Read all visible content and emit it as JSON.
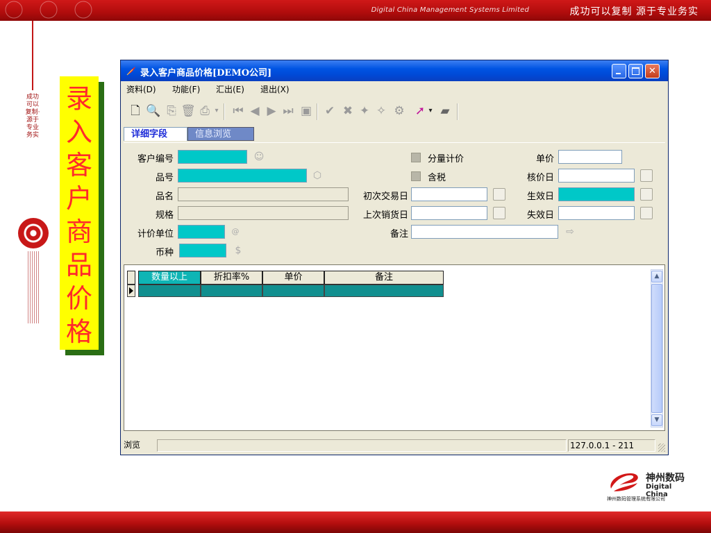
{
  "header": {
    "tagline_en": "Digital China Management Systems Limited",
    "tagline_cn": "成功可以复制   源于专业务实"
  },
  "side_deco_text": "成功可以复制·源于专业务实",
  "slide_title": "录入客户商品价格",
  "window": {
    "title": "录入客户商品价格[DEMO公司]",
    "menu": [
      "资料(D)",
      "功能(F)",
      "汇出(E)",
      "退出(X)"
    ],
    "tabs": [
      "详细字段",
      "信息浏览"
    ],
    "form": {
      "customer_no_label": "客户编号",
      "item_no_label": "品号",
      "item_name_label": "品名",
      "spec_label": "规格",
      "price_unit_label": "计价单位",
      "currency_label": "币种",
      "qty_pricing_label": "分量计价",
      "tax_incl_label": "含税",
      "first_trade_date_label": "初次交易日",
      "last_sale_date_label": "上次销货日",
      "remark_label": "备注",
      "unit_price_label": "单价",
      "approve_date_label": "核价日",
      "effective_date_label": "生效日",
      "expire_date_label": "失效日"
    },
    "grid_columns": [
      "数量以上",
      "折扣率%",
      "单价",
      "备注"
    ],
    "status": {
      "mode": "浏览",
      "server": "127.0.0.1 - 211"
    }
  },
  "logo": {
    "name_cn": "神州数码",
    "name_en": "Digital China",
    "company": "神州数码管理系统有限公司"
  },
  "colors": {
    "brand_red": "#c21616",
    "title_yellow": "#ffff00",
    "title_text_red": "#ff2a2a",
    "field_cyan": "#00c8c8",
    "grid_row_teal": "#118f8f",
    "xp_blue": "#0054e3"
  }
}
